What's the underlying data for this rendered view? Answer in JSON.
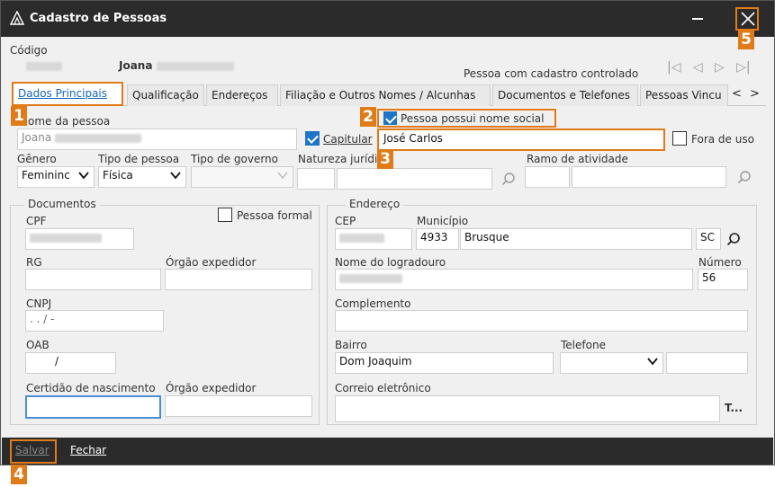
{
  "window": {
    "title": "Cadastro de Pessoas"
  },
  "header": {
    "codigo_label": "Código",
    "name_first": "Joana",
    "controlled_text": "Pessoa com cadastro controlado"
  },
  "tabs": [
    {
      "label": "Dados Principais"
    },
    {
      "label": "Qualificação"
    },
    {
      "label": "Endereços"
    },
    {
      "label": "Filiação e Outros Nomes / Alcunhas"
    },
    {
      "label": "Documentos e Telefones"
    },
    {
      "label": "Pessoas Vincu"
    }
  ],
  "tab_nav": {
    "prev": "<",
    "next": ">"
  },
  "form": {
    "nome_label": "Nome da pessoa",
    "nome_value": "Joana",
    "capitular_label": "Capitular",
    "nome_social_label": "Pessoa possui nome social",
    "nome_social_value": "José Carlos",
    "fora_de_uso_label": "Fora de uso",
    "genero_label": "Gênero",
    "genero_value": "Femininc",
    "tipo_pessoa_label": "Tipo de pessoa",
    "tipo_pessoa_value": "Física",
    "tipo_governo_label": "Tipo de governo",
    "natureza_label": "Natureza jurídi",
    "ramo_label": "Ramo de atividade"
  },
  "documentos": {
    "title": "Documentos",
    "pessoa_formal_label": "Pessoa formal",
    "cpf_label": "CPF",
    "rg_label": "RG",
    "orgao_label": "Órgão expedidor",
    "cnpj_label": "CNPJ",
    "cnpj_mask": " .  .  /    -",
    "oab_label": "OAB",
    "oab_mask": "/",
    "certidao_label": "Certidão de nascimento",
    "orgao2_label": "Órgão expedidor"
  },
  "endereco": {
    "title": "Endereço",
    "cep_label": "CEP",
    "municipio_label": "Município",
    "municipio_code": "4933",
    "municipio_name": "Brusque",
    "uf": "SC",
    "logradouro_label": "Nome do logradouro",
    "numero_label": "Número",
    "numero_value": "56",
    "complemento_label": "Complemento",
    "bairro_label": "Bairro",
    "bairro_value": "Dom Joaquim",
    "telefone_label": "Telefone",
    "email_label": "Correio eletrônico",
    "email_btn": "T..."
  },
  "footer": {
    "salvar": "Salvar",
    "fechar": "Fechar"
  },
  "badges": [
    "1",
    "2",
    "3",
    "4",
    "5"
  ],
  "colors": {
    "accent": "#e07b1a",
    "titlebar": "#2b2b2b",
    "check": "#1e74c7",
    "tab_active_text": "#1565c0"
  }
}
